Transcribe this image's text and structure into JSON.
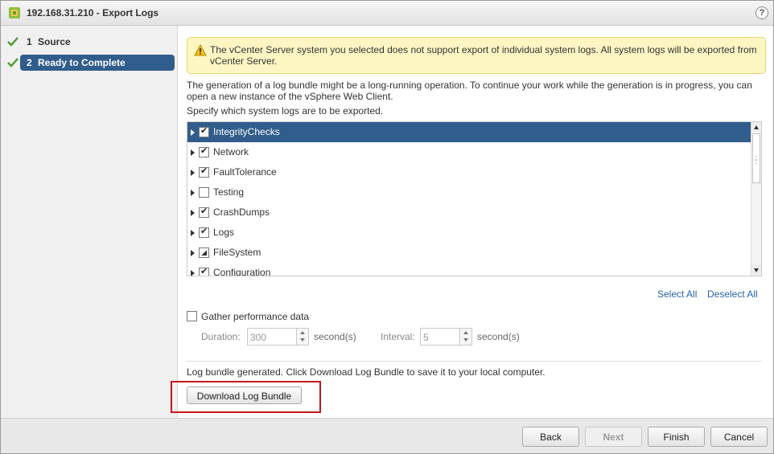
{
  "window": {
    "title": "192.168.31.210 - Export Logs",
    "help_icon": "?"
  },
  "sidebar": {
    "steps": [
      {
        "num": "1",
        "label": "Source",
        "status": "done"
      },
      {
        "num": "2",
        "label": "Ready to Complete",
        "status": "current"
      }
    ]
  },
  "main": {
    "warning": "The vCenter Server system you selected does not support export of individual system logs. All system logs will be exported from vCenter Server.",
    "description": "The generation of a log bundle might be a long-running operation. To continue your work while the generation is in progress, you can open a new instance of the vSphere Web Client.",
    "specify_label": "Specify which system logs are to be exported.",
    "logs": [
      {
        "label": "IntegrityChecks",
        "state": "checked",
        "selected": true
      },
      {
        "label": "Network",
        "state": "checked"
      },
      {
        "label": "FaultTolerance",
        "state": "checked"
      },
      {
        "label": "Testing",
        "state": "unchecked"
      },
      {
        "label": "CrashDumps",
        "state": "checked"
      },
      {
        "label": "Logs",
        "state": "checked"
      },
      {
        "label": "FileSystem",
        "state": "partial"
      },
      {
        "label": "Configuration",
        "state": "checked"
      }
    ],
    "select_all": "Select All",
    "deselect_all": "Deselect All",
    "gather_perf": "Gather performance data",
    "duration_label": "Duration:",
    "duration_value": "300",
    "duration_unit": "second(s)",
    "interval_label": "Interval:",
    "interval_value": "5",
    "interval_unit": "second(s)",
    "generated_text": "Log bundle generated. Click Download Log Bundle to save it to your local computer.",
    "download_button": "Download Log Bundle"
  },
  "footer": {
    "back": "Back",
    "next": "Next",
    "finish": "Finish",
    "cancel": "Cancel"
  },
  "colors": {
    "accent": "#315d8c",
    "link": "#2763a8",
    "highlight_box": "#c8161d",
    "warning_bg": "#fdf6c3"
  }
}
